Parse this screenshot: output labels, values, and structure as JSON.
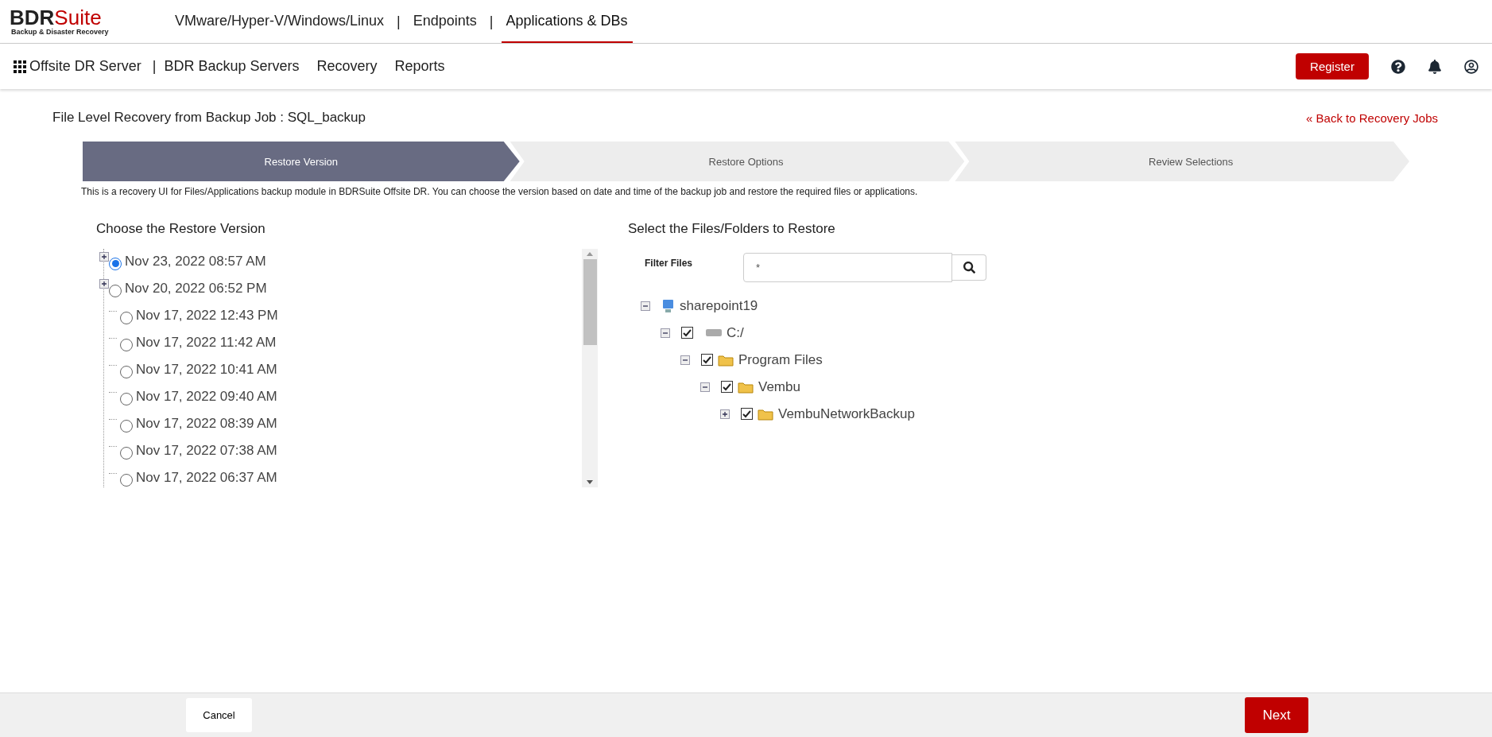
{
  "brand": {
    "name_dark": "BDR",
    "name_red": "Suite",
    "tagline": "Backup & Disaster Recovery"
  },
  "top_tabs": [
    {
      "label": "VMware/Hyper-V/Windows/Linux",
      "selected": false
    },
    {
      "label": "Endpoints",
      "selected": false
    },
    {
      "label": "Applications & DBs",
      "selected": true
    }
  ],
  "top_tab_separators": [
    "|",
    "|"
  ],
  "nav": {
    "product": "Offsite DR Server",
    "separator": "|",
    "items": [
      "BDR Backup Servers",
      "Recovery",
      "Reports"
    ],
    "register": "Register"
  },
  "page": {
    "title": "File Level Recovery from Backup Job : SQL_backup",
    "back_link": "« Back to Recovery Jobs"
  },
  "steps": [
    {
      "label": "Restore Version",
      "selected": true
    },
    {
      "label": "Restore Options",
      "selected": false
    },
    {
      "label": "Review Selections",
      "selected": false
    }
  ],
  "description": "This is a recovery UI for Files/Applications backup module in BDRSuite Offsite DR. You can choose the version based on date and time of the backup job and restore the required files or applications.",
  "versions": {
    "heading": "Choose the Restore Version",
    "items": [
      {
        "label": "Nov 23, 2022 08:57 AM",
        "selected": true,
        "expandable": true
      },
      {
        "label": "Nov 20, 2022 06:52 PM",
        "selected": false,
        "expandable": true
      },
      {
        "label": "Nov 17, 2022 12:43 PM",
        "selected": false,
        "expandable": false
      },
      {
        "label": "Nov 17, 2022 11:42 AM",
        "selected": false,
        "expandable": false
      },
      {
        "label": "Nov 17, 2022 10:41 AM",
        "selected": false,
        "expandable": false
      },
      {
        "label": "Nov 17, 2022 09:40 AM",
        "selected": false,
        "expandable": false
      },
      {
        "label": "Nov 17, 2022 08:39 AM",
        "selected": false,
        "expandable": false
      },
      {
        "label": "Nov 17, 2022 07:38 AM",
        "selected": false,
        "expandable": false
      },
      {
        "label": "Nov 17, 2022 06:37 AM",
        "selected": false,
        "expandable": false
      }
    ]
  },
  "files": {
    "heading": "Select the Files/Folders to Restore",
    "filter_label": "Filter Files",
    "filter_value": "*",
    "tree": [
      {
        "label": "sharepoint19",
        "kind": "computer",
        "expanded": true,
        "children": [
          {
            "label": "C:/",
            "kind": "drive",
            "expanded": true,
            "checked": true,
            "children": [
              {
                "label": "Program Files",
                "kind": "folder",
                "expanded": true,
                "checked": true,
                "children": [
                  {
                    "label": "Vembu",
                    "kind": "folder",
                    "expanded": true,
                    "checked": true,
                    "children": [
                      {
                        "label": "VembuNetworkBackup",
                        "kind": "folder",
                        "expanded": false,
                        "checked": true
                      }
                    ]
                  }
                ]
              }
            ]
          }
        ]
      }
    ]
  },
  "footer": {
    "cancel": "Cancel",
    "next": "Next"
  }
}
